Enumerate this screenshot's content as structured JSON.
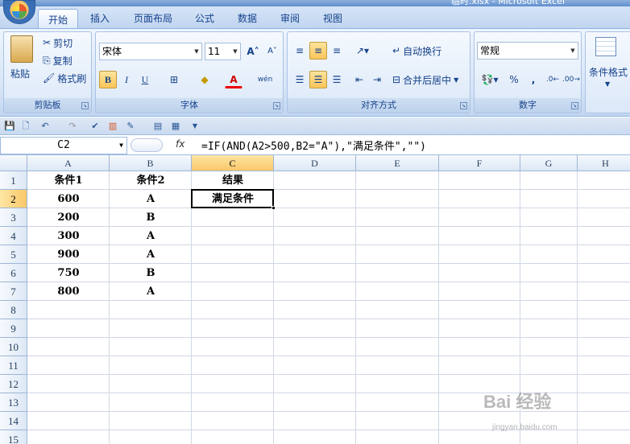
{
  "window": {
    "title": "临时.xlsx - Microsoft Excel"
  },
  "ribbon_tabs": [
    {
      "label": "开始",
      "active": true
    },
    {
      "label": "插入"
    },
    {
      "label": "页面布局"
    },
    {
      "label": "公式"
    },
    {
      "label": "数据"
    },
    {
      "label": "审阅"
    },
    {
      "label": "视图"
    }
  ],
  "clipboard": {
    "paste": "粘贴",
    "cut": "剪切",
    "copy": "复制",
    "format_painter": "格式刷",
    "label": "剪贴板"
  },
  "font": {
    "name": "宋体",
    "size": "11",
    "grow": "A",
    "shrink": "A",
    "bold": "B",
    "italic": "I",
    "underline": "U",
    "font_color": "A",
    "phonetic": "wén",
    "label": "字体"
  },
  "alignment": {
    "wrap": "自动换行",
    "merge": "合并后居中",
    "label": "对齐方式"
  },
  "number": {
    "format": "常规",
    "percent": "%",
    "comma": ",",
    "label": "数字"
  },
  "styles": {
    "conditional": "条件格式"
  },
  "formula_bar": {
    "name_box": "C2",
    "fx": "fx",
    "formula": "=IF(AND(A2>500,B2=\"A\"),\"满足条件\",\"\")"
  },
  "columns": [
    "A",
    "B",
    "C",
    "D",
    "E",
    "F",
    "G",
    "H"
  ],
  "rows": [
    "1",
    "2",
    "3",
    "4",
    "5",
    "6",
    "7",
    "8",
    "9",
    "10",
    "11",
    "12",
    "13",
    "14",
    "15"
  ],
  "cells": {
    "A1": "条件1",
    "B1": "条件2",
    "C1": "结果",
    "A2": "600",
    "B2": "A",
    "C2": "满足条件",
    "A3": "200",
    "B3": "B",
    "A4": "300",
    "B4": "A",
    "A5": "900",
    "B5": "A",
    "A6": "750",
    "B6": "B",
    "A7": "800",
    "B7": "A"
  },
  "active_cell": "C2",
  "watermark": {
    "text": "Bai 经验",
    "url": "jingyan.baidu.com"
  }
}
